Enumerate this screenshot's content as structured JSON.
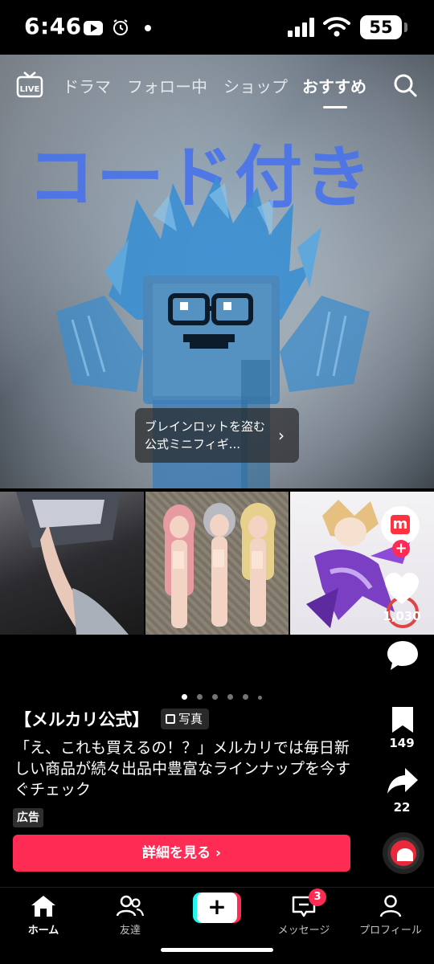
{
  "status_bar": {
    "time": "6:46",
    "battery": "55",
    "icons": [
      "youtube-icon",
      "alarm-icon",
      "signal-icon",
      "wifi-icon",
      "battery-icon"
    ]
  },
  "top_nav": {
    "live_icon": "live-icon",
    "tabs": [
      {
        "label": "ドラマ"
      },
      {
        "label": "フォロー中"
      },
      {
        "label": "ショップ"
      },
      {
        "label": "おすすめ"
      }
    ],
    "active_tab": "おすすめ",
    "search_icon": "search-icon"
  },
  "photo": {
    "printed_text": "コード付き"
  },
  "product_chip": {
    "label": "ブレインロットを盗む　公式ミニフィギ..."
  },
  "right_rail": {
    "avatar_logo_text": "m",
    "like_count": "1,030",
    "bookmark_count": "149",
    "share_count": "22"
  },
  "pager": {
    "total": 6,
    "current": 1
  },
  "caption": {
    "author": "【メルカリ公式】",
    "photo_badge": "写真",
    "text": "「え、これも買えるの！？」メルカリでは毎日新しい商品が続々出品中豊富なラインナップを今すぐチェック",
    "ad_label": "広告"
  },
  "cta": {
    "label": "詳細を見る ›"
  },
  "bottom_nav": {
    "items": [
      {
        "label": "ホーム",
        "icon": "home-icon"
      },
      {
        "label": "友達",
        "icon": "friends-icon"
      },
      {
        "label": "",
        "icon": "create-icon"
      },
      {
        "label": "メッセージ",
        "icon": "inbox-icon"
      },
      {
        "label": "プロフィール",
        "icon": "profile-icon"
      }
    ],
    "message_badge": "3"
  },
  "colors": {
    "accent": "#fe2c55",
    "create_cyan": "#25f4ee",
    "print_blue": "#4a74ea"
  }
}
